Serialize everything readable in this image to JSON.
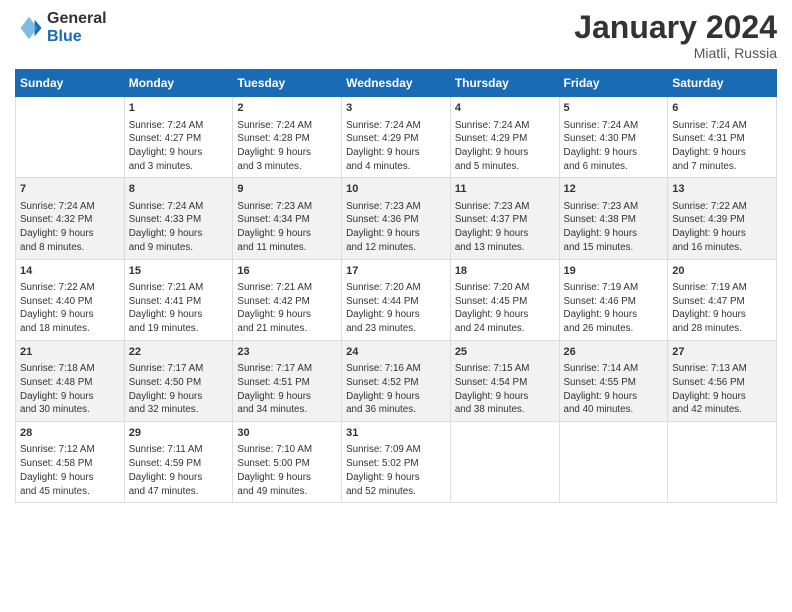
{
  "logo": {
    "general": "General",
    "blue": "Blue"
  },
  "title": "January 2024",
  "location": "Miatli, Russia",
  "days_of_week": [
    "Sunday",
    "Monday",
    "Tuesday",
    "Wednesday",
    "Thursday",
    "Friday",
    "Saturday"
  ],
  "weeks": [
    [
      {
        "num": "",
        "info": ""
      },
      {
        "num": "1",
        "info": "Sunrise: 7:24 AM\nSunset: 4:27 PM\nDaylight: 9 hours\nand 3 minutes."
      },
      {
        "num": "2",
        "info": "Sunrise: 7:24 AM\nSunset: 4:28 PM\nDaylight: 9 hours\nand 3 minutes."
      },
      {
        "num": "3",
        "info": "Sunrise: 7:24 AM\nSunset: 4:29 PM\nDaylight: 9 hours\nand 4 minutes."
      },
      {
        "num": "4",
        "info": "Sunrise: 7:24 AM\nSunset: 4:29 PM\nDaylight: 9 hours\nand 5 minutes."
      },
      {
        "num": "5",
        "info": "Sunrise: 7:24 AM\nSunset: 4:30 PM\nDaylight: 9 hours\nand 6 minutes."
      },
      {
        "num": "6",
        "info": "Sunrise: 7:24 AM\nSunset: 4:31 PM\nDaylight: 9 hours\nand 7 minutes."
      }
    ],
    [
      {
        "num": "7",
        "info": "Sunrise: 7:24 AM\nSunset: 4:32 PM\nDaylight: 9 hours\nand 8 minutes."
      },
      {
        "num": "8",
        "info": "Sunrise: 7:24 AM\nSunset: 4:33 PM\nDaylight: 9 hours\nand 9 minutes."
      },
      {
        "num": "9",
        "info": "Sunrise: 7:23 AM\nSunset: 4:34 PM\nDaylight: 9 hours\nand 11 minutes."
      },
      {
        "num": "10",
        "info": "Sunrise: 7:23 AM\nSunset: 4:36 PM\nDaylight: 9 hours\nand 12 minutes."
      },
      {
        "num": "11",
        "info": "Sunrise: 7:23 AM\nSunset: 4:37 PM\nDaylight: 9 hours\nand 13 minutes."
      },
      {
        "num": "12",
        "info": "Sunrise: 7:23 AM\nSunset: 4:38 PM\nDaylight: 9 hours\nand 15 minutes."
      },
      {
        "num": "13",
        "info": "Sunrise: 7:22 AM\nSunset: 4:39 PM\nDaylight: 9 hours\nand 16 minutes."
      }
    ],
    [
      {
        "num": "14",
        "info": "Sunrise: 7:22 AM\nSunset: 4:40 PM\nDaylight: 9 hours\nand 18 minutes."
      },
      {
        "num": "15",
        "info": "Sunrise: 7:21 AM\nSunset: 4:41 PM\nDaylight: 9 hours\nand 19 minutes."
      },
      {
        "num": "16",
        "info": "Sunrise: 7:21 AM\nSunset: 4:42 PM\nDaylight: 9 hours\nand 21 minutes."
      },
      {
        "num": "17",
        "info": "Sunrise: 7:20 AM\nSunset: 4:44 PM\nDaylight: 9 hours\nand 23 minutes."
      },
      {
        "num": "18",
        "info": "Sunrise: 7:20 AM\nSunset: 4:45 PM\nDaylight: 9 hours\nand 24 minutes."
      },
      {
        "num": "19",
        "info": "Sunrise: 7:19 AM\nSunset: 4:46 PM\nDaylight: 9 hours\nand 26 minutes."
      },
      {
        "num": "20",
        "info": "Sunrise: 7:19 AM\nSunset: 4:47 PM\nDaylight: 9 hours\nand 28 minutes."
      }
    ],
    [
      {
        "num": "21",
        "info": "Sunrise: 7:18 AM\nSunset: 4:48 PM\nDaylight: 9 hours\nand 30 minutes."
      },
      {
        "num": "22",
        "info": "Sunrise: 7:17 AM\nSunset: 4:50 PM\nDaylight: 9 hours\nand 32 minutes."
      },
      {
        "num": "23",
        "info": "Sunrise: 7:17 AM\nSunset: 4:51 PM\nDaylight: 9 hours\nand 34 minutes."
      },
      {
        "num": "24",
        "info": "Sunrise: 7:16 AM\nSunset: 4:52 PM\nDaylight: 9 hours\nand 36 minutes."
      },
      {
        "num": "25",
        "info": "Sunrise: 7:15 AM\nSunset: 4:54 PM\nDaylight: 9 hours\nand 38 minutes."
      },
      {
        "num": "26",
        "info": "Sunrise: 7:14 AM\nSunset: 4:55 PM\nDaylight: 9 hours\nand 40 minutes."
      },
      {
        "num": "27",
        "info": "Sunrise: 7:13 AM\nSunset: 4:56 PM\nDaylight: 9 hours\nand 42 minutes."
      }
    ],
    [
      {
        "num": "28",
        "info": "Sunrise: 7:12 AM\nSunset: 4:58 PM\nDaylight: 9 hours\nand 45 minutes."
      },
      {
        "num": "29",
        "info": "Sunrise: 7:11 AM\nSunset: 4:59 PM\nDaylight: 9 hours\nand 47 minutes."
      },
      {
        "num": "30",
        "info": "Sunrise: 7:10 AM\nSunset: 5:00 PM\nDaylight: 9 hours\nand 49 minutes."
      },
      {
        "num": "31",
        "info": "Sunrise: 7:09 AM\nSunset: 5:02 PM\nDaylight: 9 hours\nand 52 minutes."
      },
      {
        "num": "",
        "info": ""
      },
      {
        "num": "",
        "info": ""
      },
      {
        "num": "",
        "info": ""
      }
    ]
  ]
}
